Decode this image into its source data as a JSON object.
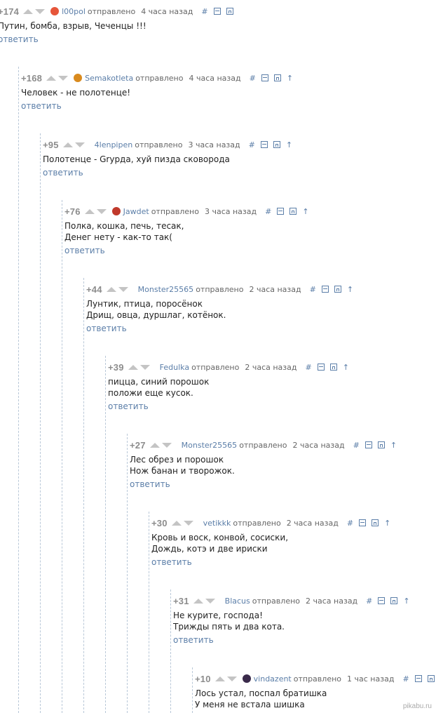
{
  "comments": [
    {
      "rating": "+174",
      "user": "l00pol",
      "sent": "отправлено",
      "time": "4 часа назад",
      "lines": [
        "Путин, бомба, взрыв, Чеченцы !!!"
      ],
      "reply": "ответить",
      "avatar": "#e6553a"
    },
    {
      "rating": "+168",
      "user": "Semakotleta",
      "sent": "отправлено",
      "time": "4 часа назад",
      "lines": [
        "Человек - не полотенце!"
      ],
      "reply": "ответить",
      "avatar": "#d98a1e"
    },
    {
      "rating": "+95",
      "user": "4lenpipen",
      "sent": "отправлено",
      "time": "3 часа назад",
      "lines": [
        "Полотенце - Grурда, хуй пизда сковорода"
      ],
      "reply": "ответить",
      "avatar": ""
    },
    {
      "rating": "+76",
      "user": "Jawdet",
      "sent": "отправлено",
      "time": "3 часа назад",
      "lines": [
        "Полка, кошка, печь, тесак,",
        "Денег нету - как-то так("
      ],
      "reply": "ответить",
      "avatar": "#c0392b"
    },
    {
      "rating": "+44",
      "user": "Monster25565",
      "sent": "отправлено",
      "time": "2 часа назад",
      "lines": [
        "Лунтик, птица, поросёнок",
        "Дрищ, овца, дуршлаг, котёнок."
      ],
      "reply": "ответить",
      "avatar": ""
    },
    {
      "rating": "+39",
      "user": "Fedulka",
      "sent": "отправлено",
      "time": "2 часа назад",
      "lines": [
        "пицца, синий порошок",
        "положи еще кусок."
      ],
      "reply": "ответить",
      "avatar": ""
    },
    {
      "rating": "+27",
      "user": "Monster25565",
      "sent": "отправлено",
      "time": "2 часа назад",
      "lines": [
        "Лес обрез и порошок",
        "Нож банан и творожок."
      ],
      "reply": "ответить",
      "avatar": ""
    },
    {
      "rating": "+30",
      "user": "vetikkk",
      "sent": "отправлено",
      "time": "2 часа назад",
      "lines": [
        "Кровь и воск, конвой, сосиски,",
        "Дождь, котэ и две ириски"
      ],
      "reply": "ответить",
      "avatar": ""
    },
    {
      "rating": "+31",
      "user": "Blacus",
      "sent": "отправлено",
      "time": "2 часа назад",
      "lines": [
        "Не курите, господа!",
        "Трижды пять и два кота."
      ],
      "reply": "ответить",
      "avatar": ""
    },
    {
      "rating": "+10",
      "user": "vindazent",
      "sent": "отправлено",
      "time": "1 час назад",
      "lines": [
        "Лось устал, поспал братишка",
        "У меня не встала шишка"
      ],
      "reply": "",
      "avatar": "#3a2a4a"
    }
  ],
  "tools": {
    "hash": "#"
  },
  "watermark": "pikabu.ru"
}
